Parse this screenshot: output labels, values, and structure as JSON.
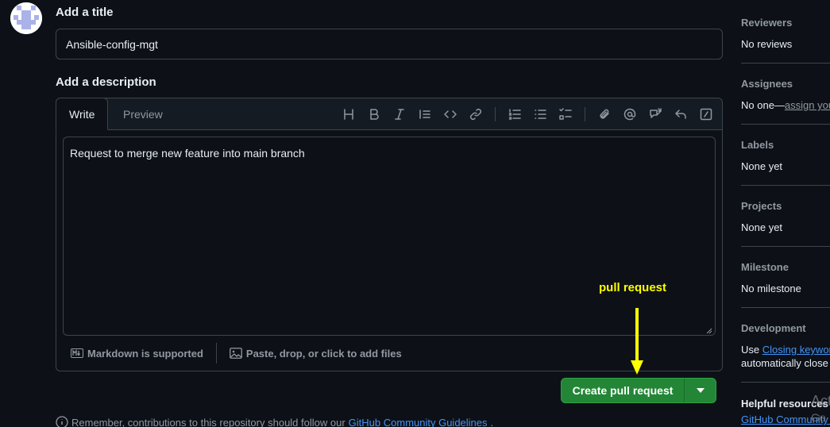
{
  "title_section": {
    "label": "Add a title",
    "value": "Ansible-config-mgt"
  },
  "description_section": {
    "label": "Add a description",
    "tabs": [
      "Write",
      "Preview"
    ],
    "body": "Request to merge new feature into main branch",
    "toolbar_icons": [
      "heading-icon",
      "bold-icon",
      "italic-icon",
      "quote-icon",
      "code-icon",
      "link-icon",
      "numbered-list-icon",
      "bulleted-list-icon",
      "task-list-icon",
      "attach-icon",
      "mention-icon",
      "reference-icon",
      "reply-icon",
      "slash-commands-icon"
    ],
    "markdown_note": "Markdown is supported",
    "attach_note": "Paste, drop, or click to add files"
  },
  "annotation": {
    "text": "pull request",
    "color": "#ffff00"
  },
  "create_button": {
    "label": "Create pull request",
    "color": "#238636"
  },
  "footer": {
    "prefix": "Remember, contributions to this repository should follow our",
    "link": "GitHub Community Guidelines",
    "suffix": "."
  },
  "sidebar": {
    "reviewers": {
      "heading": "Reviewers",
      "value": "No reviews"
    },
    "assignees": {
      "heading": "Assignees",
      "value": "No one—",
      "link": "assign yourself"
    },
    "labels": {
      "heading": "Labels",
      "value": "None yet"
    },
    "projects": {
      "heading": "Projects",
      "value": "None yet"
    },
    "milestone": {
      "heading": "Milestone",
      "value": "No milestone"
    },
    "development": {
      "heading": "Development",
      "prefix": "Use ",
      "link": "Closing keywords",
      "line2": "automatically close is"
    },
    "helpful": {
      "heading": "Helpful resources",
      "link": "GitHub Community G"
    }
  },
  "watermark": {
    "line1": "Act",
    "line2": "Go t"
  }
}
